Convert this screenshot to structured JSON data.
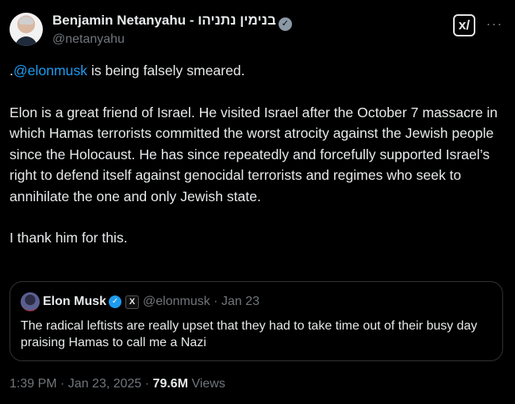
{
  "author": {
    "display_name": "Benjamin Netanyahu - בנימין נתניהו",
    "handle": "@netanyahu",
    "verified_badge": "gray-check"
  },
  "actions": {
    "grok_icon": "grok-icon",
    "more_icon": "more-options-icon",
    "grok_glyph": "x/",
    "more_glyph": "···"
  },
  "tweet": {
    "line1_prefix": ".",
    "line1_mention": "@elonmusk",
    "line1_suffix": " is being falsely smeared.",
    "paragraph2": "Elon is a great friend of Israel.  He visited Israel after the October 7 massacre in which Hamas terrorists committed the worst atrocity against the Jewish people since the Holocaust. He has since repeatedly and forcefully supported Israel’s right to defend itself against genocidal terrorists and regimes who seek to annihilate the one and only Jewish state.",
    "paragraph3": "I thank him for this."
  },
  "quote": {
    "name": "Elon Musk",
    "handle_date": "@elonmusk · Jan 23",
    "text": "The radical leftists are really upset that they had to take time out of their busy day praising Hamas to call me a Nazi",
    "badge_glyph": "X"
  },
  "footer": {
    "timestamp": "1:39 PM · Jan 23, 2025 · ",
    "views_count": "79.6M",
    "views_label": " Views"
  },
  "colors": {
    "background": "#000000",
    "text": "#e7e9ea",
    "muted": "#71767b",
    "link": "#1d9bf0",
    "border": "#2f3336"
  }
}
